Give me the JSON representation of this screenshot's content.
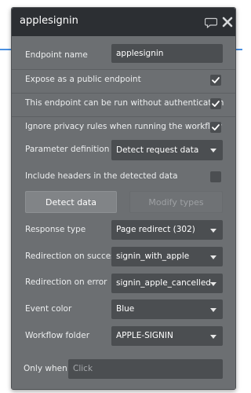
{
  "panel": {
    "title": "applesignin"
  },
  "fields": {
    "endpoint_name_label": "Endpoint name",
    "endpoint_name_value": "applesignin",
    "expose_public_label": "Expose as a public endpoint",
    "expose_public_checked": true,
    "no_auth_label": "This endpoint can be run without authentication",
    "no_auth_checked": true,
    "ignore_privacy_label": "Ignore privacy rules when running the workflow",
    "ignore_privacy_checked": true,
    "parameter_definition_label": "Parameter definition",
    "parameter_definition_value": "Detect request data",
    "include_headers_label": "Include headers in the detected data",
    "include_headers_checked": false,
    "response_type_label": "Response type",
    "response_type_value": "Page redirect (302)",
    "redirect_success_label": "Redirection on succes",
    "redirect_success_value": "signin_with_apple",
    "redirect_error_label": "Redirection on error",
    "redirect_error_value": "signin_apple_cancelled",
    "event_color_label": "Event color",
    "event_color_value": "Blue",
    "workflow_folder_label": "Workflow folder",
    "workflow_folder_value": "APPLE-SIGNIN",
    "only_when_label": "Only when",
    "only_when_placeholder": "Click"
  },
  "buttons": {
    "detect_data": "Detect data",
    "modify_types": "Modify types"
  },
  "icons": {
    "comment": "comment-icon",
    "close": "close-icon",
    "check": "check-icon",
    "caret": "chevron-down-icon"
  },
  "colors": {
    "panel_bg": "#6c6f72",
    "titlebar_bg": "#2c2f33",
    "field_bg": "#4b4e51",
    "accent_line": "#4a90e2"
  }
}
